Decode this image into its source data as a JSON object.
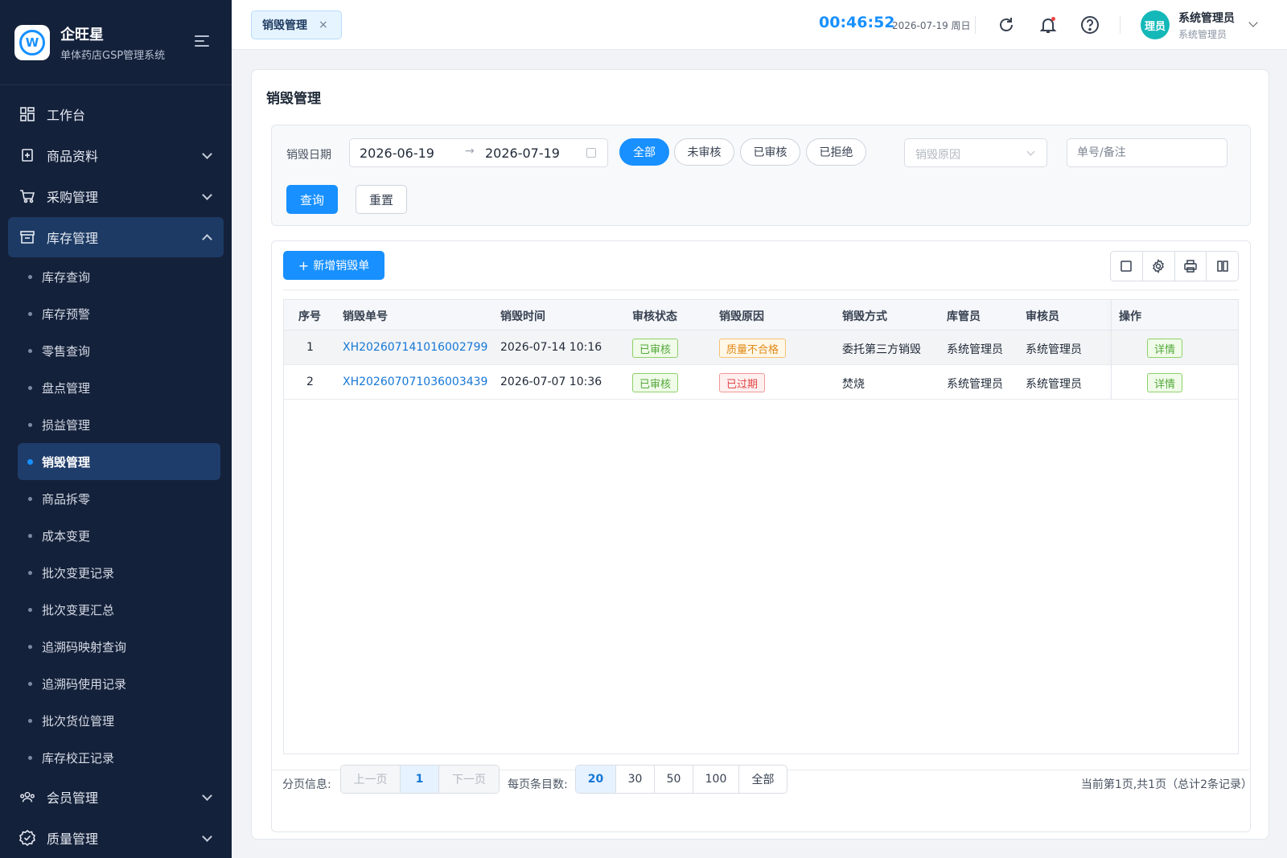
{
  "brand": {
    "name": "企旺星",
    "subtitle": "单体药店GSP管理系统",
    "logo_letter": "W"
  },
  "sidebar": {
    "items": [
      {
        "label": "工作台",
        "icon": "dashboard-icon"
      },
      {
        "label": "商品资料",
        "icon": "goods-icon"
      },
      {
        "label": "采购管理",
        "icon": "cart-icon"
      },
      {
        "label": "库存管理",
        "icon": "inventory-icon"
      }
    ],
    "sub_items": [
      "库存查询",
      "库存预警",
      "零售查询",
      "盘点管理",
      "损益管理",
      "销毁管理",
      "商品拆零",
      "成本变更",
      "批次变更记录",
      "批次变更汇总",
      "追溯码映射查询",
      "追溯码使用记录",
      "批次货位管理",
      "库存校正记录"
    ],
    "active_sub": "销毁管理",
    "bottom_items": [
      {
        "label": "会员管理",
        "icon": "members-icon"
      },
      {
        "label": "质量管理",
        "icon": "quality-icon"
      }
    ]
  },
  "topbar": {
    "tab_label": "销毁管理",
    "tab_close": "×",
    "clock": "00:46:52",
    "date": "2026-07-19 周日",
    "user_avatar": "理员",
    "user_name": "系统管理员",
    "user_role": "系统管理员"
  },
  "page": {
    "title": "销毁管理"
  },
  "filter": {
    "date_label": "销毁日期",
    "date_start": "2026-06-19",
    "date_arrow": "→",
    "date_end": "2026-07-19",
    "status_options": [
      "全部",
      "未审核",
      "已审核",
      "已拒绝"
    ],
    "status_selected": "全部",
    "reason_placeholder": "销毁原因",
    "search_placeholder": "单号/备注",
    "query_label": "查询",
    "reset_label": "重置"
  },
  "toolbar": {
    "add_label": "新增销毁单",
    "add_plus": "+"
  },
  "table": {
    "columns": [
      "序号",
      "销毁单号",
      "销毁时间",
      "审核状态",
      "销毁原因",
      "销毁方式",
      "库管员",
      "审核员",
      "操作"
    ],
    "rows": [
      {
        "index": "1",
        "order_no": "XH202607141016002799",
        "time": "2026-07-14 10:16",
        "status": "已审核",
        "reason": "质量不合格",
        "method": "委托第三方销毁",
        "keeper": "系统管理员",
        "auditor": "系统管理员",
        "action": "详情"
      },
      {
        "index": "2",
        "order_no": "XH202607071036003439",
        "time": "2026-07-07 10:36",
        "status": "已审核",
        "reason": "已过期",
        "method": "焚烧",
        "keeper": "系统管理员",
        "auditor": "系统管理员",
        "action": "详情"
      }
    ]
  },
  "pagination": {
    "label": "分页信息:",
    "prev": "上一页",
    "current": "1",
    "next": "下一页",
    "size_label": "每页条目数:",
    "sizes": [
      "20",
      "30",
      "50",
      "100",
      "全部"
    ],
    "size_selected": "20",
    "summary": "当前第1页,共1页（总计2条记录）"
  },
  "colors": {
    "primary": "#1890ff",
    "sidebar_bg": "#14213a",
    "success": "#52a83a",
    "warning": "#e08a16",
    "danger": "#e04545"
  }
}
